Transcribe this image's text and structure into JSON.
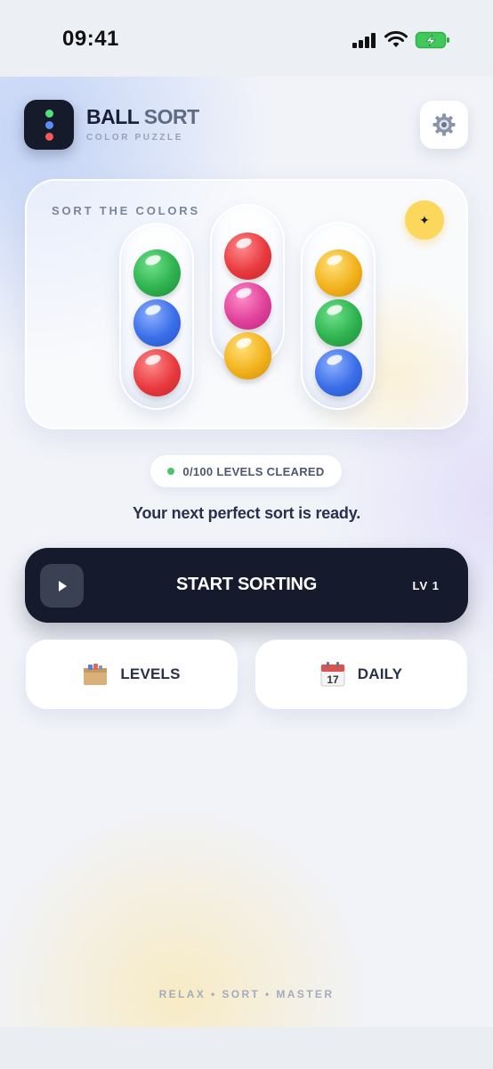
{
  "status_bar": {
    "time": "09:41"
  },
  "header": {
    "title_part1": "BALL",
    "title_part2": "SORT",
    "subtitle": "COLOR PUZZLE",
    "logo_dot_colors": [
      "#4ee07a",
      "#5b8df5",
      "#f25a5a"
    ]
  },
  "preview": {
    "label": "SORT THE COLORS",
    "badge_icon": "sparkle-icon",
    "tubes": [
      {
        "balls": [
          "green",
          "blue",
          "red"
        ]
      },
      {
        "balls": [
          "red",
          "pink",
          "yellow"
        ]
      },
      {
        "balls": [
          "yellow",
          "green",
          "blue"
        ]
      }
    ],
    "ball_colors": {
      "green": "#2eb24f",
      "blue": "#3a6ee8",
      "red": "#e83a3f",
      "pink": "#e0409a",
      "yellow": "#f2b21b"
    }
  },
  "progress": {
    "text": "0/100 LEVELS CLEARED"
  },
  "tagline": "Your next perfect sort is ready.",
  "start_button": {
    "label": "START SORTING",
    "level": "LV 1"
  },
  "levels_button": {
    "label": "LEVELS",
    "icon": "box-icon"
  },
  "daily_button": {
    "label": "DAILY",
    "icon": "calendar-icon",
    "calendar_day": "17"
  },
  "footer": "RELAX • SORT • MASTER",
  "colors": {
    "dark": "#151b2c",
    "accent_yellow": "#fbd85c",
    "success_green": "#4cc46a"
  }
}
